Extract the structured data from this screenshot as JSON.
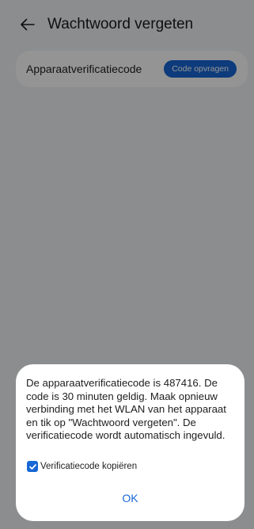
{
  "header": {
    "title": "Wachtwoord vergeten",
    "back_icon": "arrow-left-icon"
  },
  "field": {
    "label": "Apparaatverificatiecode",
    "button_label": "Code opvragen"
  },
  "dialog": {
    "message": "De apparaatverificatiecode is 487416. De code is 30 minuten geldig. Maak opnieuw verbinding met het WLAN van het apparaat en tik op \"Wachtwoord vergeten\". De verificatiecode wordt automatisch ingevuld.",
    "checkbox_label": "Verificatiecode kopiëren",
    "checkbox_checked": true,
    "ok_label": "OK"
  },
  "colors": {
    "accent": "#1867d6",
    "background": "#f1f3f5",
    "card": "#ffffff"
  }
}
